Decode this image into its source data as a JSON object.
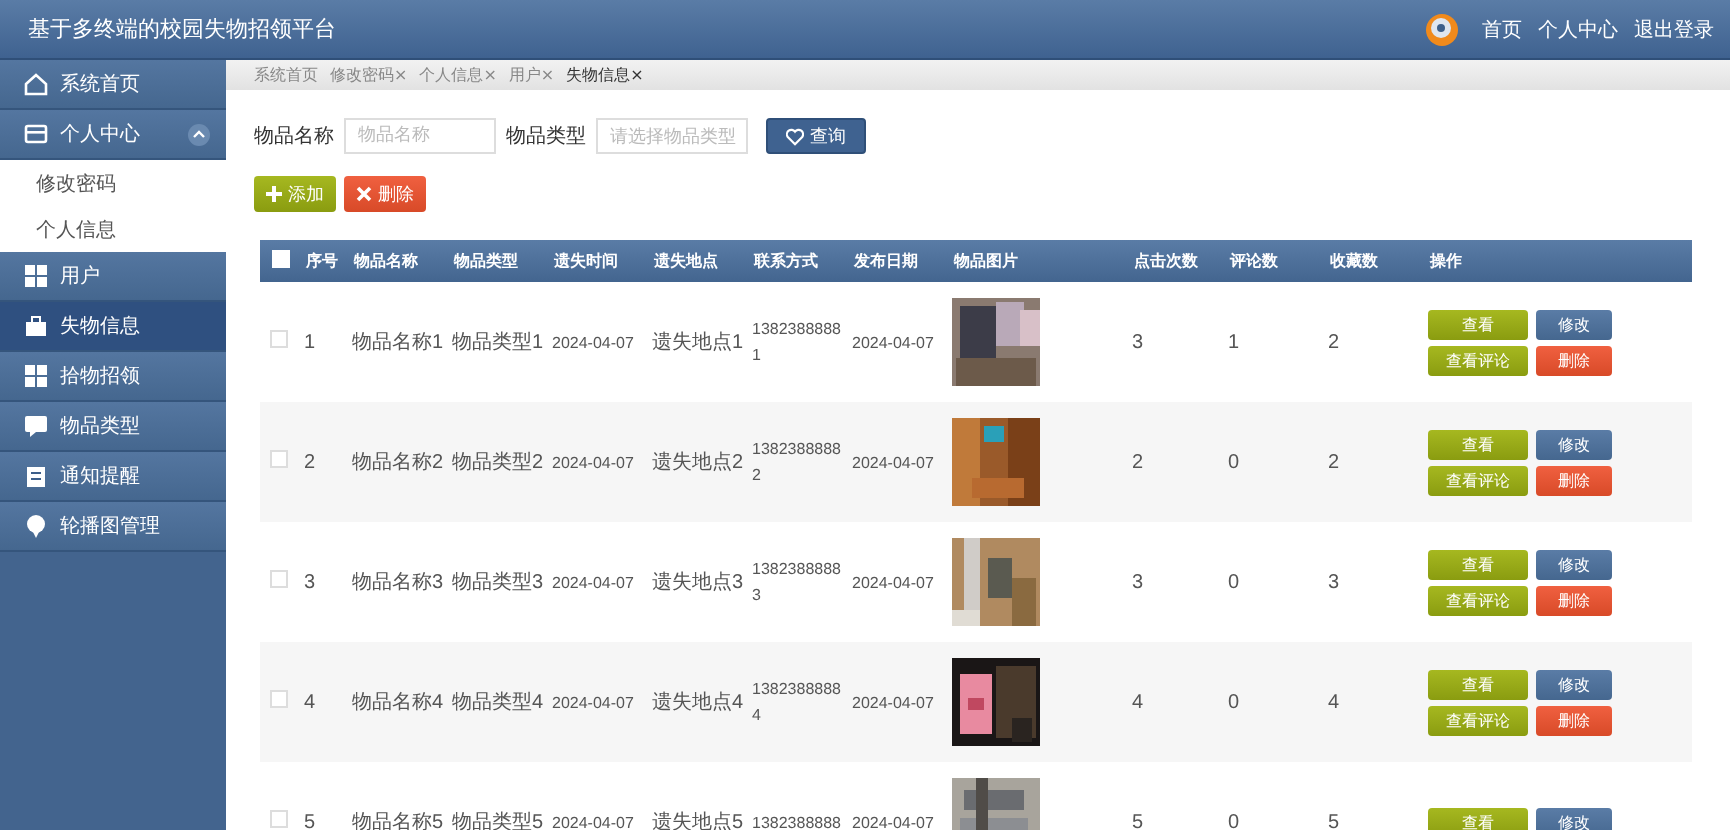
{
  "app_title": "基于多终端的校园失物招领平台",
  "top_nav": [
    {
      "label": "首页"
    },
    {
      "label": "个人中心"
    },
    {
      "label": "退出登录"
    }
  ],
  "sidebar": {
    "items": [
      {
        "label": "系统首页",
        "selected": false
      },
      {
        "label": "个人中心",
        "selected": false,
        "expanded": true,
        "children": [
          {
            "label": "修改密码"
          },
          {
            "label": "个人信息"
          }
        ]
      },
      {
        "label": "用户",
        "selected": false
      },
      {
        "label": "失物信息",
        "selected": true
      },
      {
        "label": "拾物招领",
        "selected": false
      },
      {
        "label": "物品类型",
        "selected": false
      },
      {
        "label": "通知提醒",
        "selected": false
      },
      {
        "label": "轮播图管理",
        "selected": false
      }
    ]
  },
  "breadcrumbs": [
    {
      "label": "系统首页",
      "selected": false
    },
    {
      "label": "修改密码×",
      "selected": false
    },
    {
      "label": "个人信息×",
      "selected": false
    },
    {
      "label": "用户×",
      "selected": false
    },
    {
      "label": "失物信息×",
      "selected": true
    }
  ],
  "search": {
    "fields": [
      {
        "kind": "input",
        "label": "物品名称",
        "placeholder": "物品名称"
      },
      {
        "kind": "select",
        "label": "物品类型",
        "placeholder": "请选择物品类型"
      }
    ],
    "button": "查询"
  },
  "actions": [
    {
      "kind": "add",
      "label": "添加"
    },
    {
      "kind": "delete",
      "label": "删除"
    }
  ],
  "table": {
    "header_checked": false,
    "columns": [
      "序号",
      "物品名称",
      "物品类型",
      "遗失时间",
      "遗失地点",
      "联系方式",
      "发布日期",
      "物品图片",
      "点击次数",
      "评论数",
      "收藏数",
      "操作"
    ],
    "rows": [
      {
        "checked": false,
        "cells": [
          "1",
          "物品名称1",
          "物品类型1",
          "2024-04-07",
          "遗失地点1",
          "13823888881",
          "2024-04-07",
          {
            "kind": "picture"
          },
          "3",
          "1",
          "2"
        ],
        "buttons": [
          {
            "kind": "view",
            "label": "查看"
          },
          {
            "kind": "edit",
            "label": "修改"
          },
          {
            "kind": "view",
            "label": "查看评论"
          },
          {
            "kind": "delete",
            "label": "删除"
          }
        ]
      },
      {
        "checked": false,
        "cells": [
          "2",
          "物品名称2",
          "物品类型2",
          "2024-04-07",
          "遗失地点2",
          "13823888882",
          "2024-04-07",
          {
            "kind": "picture"
          },
          "2",
          "0",
          "2"
        ],
        "buttons": [
          {
            "kind": "view",
            "label": "查看"
          },
          {
            "kind": "edit",
            "label": "修改"
          },
          {
            "kind": "view",
            "label": "查看评论"
          },
          {
            "kind": "delete",
            "label": "删除"
          }
        ]
      },
      {
        "checked": false,
        "cells": [
          "3",
          "物品名称3",
          "物品类型3",
          "2024-04-07",
          "遗失地点3",
          "13823888883",
          "2024-04-07",
          {
            "kind": "picture"
          },
          "3",
          "0",
          "3"
        ],
        "buttons": [
          {
            "kind": "view",
            "label": "查看"
          },
          {
            "kind": "edit",
            "label": "修改"
          },
          {
            "kind": "view",
            "label": "查看评论"
          },
          {
            "kind": "delete",
            "label": "删除"
          }
        ]
      },
      {
        "checked": false,
        "cells": [
          "4",
          "物品名称4",
          "物品类型4",
          "2024-04-07",
          "遗失地点4",
          "13823888884",
          "2024-04-07",
          {
            "kind": "picture"
          },
          "4",
          "0",
          "4"
        ],
        "buttons": [
          {
            "kind": "view",
            "label": "查看"
          },
          {
            "kind": "edit",
            "label": "修改"
          },
          {
            "kind": "view",
            "label": "查看评论"
          },
          {
            "kind": "delete",
            "label": "删除"
          }
        ]
      },
      {
        "checked": false,
        "cells": [
          "5",
          "物品名称5",
          "物品类型5",
          "2024-04-07",
          "遗失地点5",
          "1382388888",
          "2024-04-07",
          {
            "kind": "picture"
          },
          "5",
          "0",
          "5"
        ],
        "buttons": [
          {
            "kind": "view",
            "label": "查看"
          },
          {
            "kind": "edit",
            "label": "修改"
          }
        ]
      }
    ]
  }
}
